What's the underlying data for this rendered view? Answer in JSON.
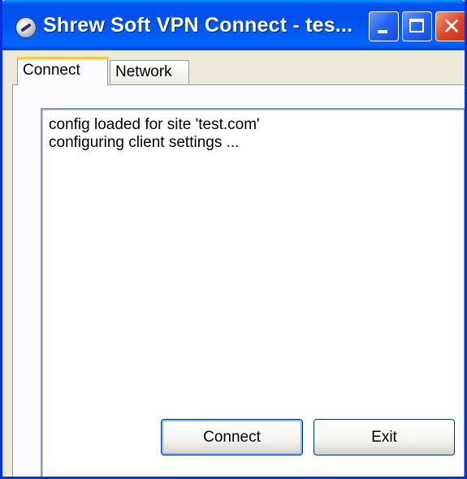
{
  "window": {
    "title": "Shrew Soft VPN Connect - tes...",
    "app_icon": "shrew-soft-vpn-icon",
    "controls": {
      "minimize": "minimize-icon",
      "maximize": "maximize-icon",
      "close": "close-icon",
      "close_glyph": "✕"
    }
  },
  "tabs": [
    {
      "label": "Connect",
      "active": true
    },
    {
      "label": "Network",
      "active": false
    }
  ],
  "log": {
    "lines": [
      "config loaded for site 'test.com'",
      "configuring client settings ..."
    ]
  },
  "buttons": {
    "connect_label": "Connect",
    "exit_label": "Exit"
  },
  "colors": {
    "titlebar_blue": "#0053ee",
    "window_face": "#ece9d8",
    "active_tab_accent": "#ffc83c",
    "close_button_red": "#e1452a"
  }
}
